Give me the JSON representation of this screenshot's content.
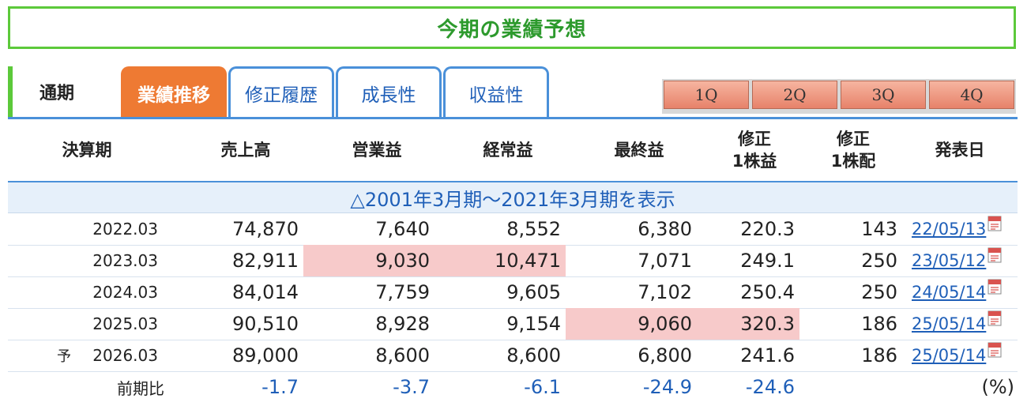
{
  "title": "今期の業績予想",
  "tabs": {
    "first": "通期",
    "items": [
      "業績推移",
      "修正履歴",
      "成長性",
      "収益性"
    ]
  },
  "quarters": [
    "1Q",
    "2Q",
    "3Q",
    "4Q"
  ],
  "header": {
    "period": "決算期",
    "sales": "売上高",
    "operating": "営業益",
    "ordinary": "経常益",
    "net": "最終益",
    "eps_l1": "修正",
    "eps_l2": "1株益",
    "div_l1": "修正",
    "div_l2": "1株配",
    "date": "発表日"
  },
  "expand_link": "△2001年3月期～2021年3月期を表示",
  "rows": [
    {
      "prefix": "",
      "period": "2022.03",
      "sales": "74,870",
      "operating": "7,640",
      "ordinary": "8,552",
      "net": "6,380",
      "eps": "220.3",
      "div": "143",
      "date": "22/05/13"
    },
    {
      "prefix": "",
      "period": "2023.03",
      "sales": "82,911",
      "operating": "9,030",
      "ordinary": "10,471",
      "net": "7,071",
      "eps": "249.1",
      "div": "250",
      "date": "23/05/12"
    },
    {
      "prefix": "",
      "period": "2024.03",
      "sales": "84,014",
      "operating": "7,759",
      "ordinary": "9,605",
      "net": "7,102",
      "eps": "250.4",
      "div": "250",
      "date": "24/05/14"
    },
    {
      "prefix": "",
      "period": "2025.03",
      "sales": "90,510",
      "operating": "8,928",
      "ordinary": "9,154",
      "net": "9,060",
      "eps": "320.3",
      "div": "186",
      "date": "25/05/14"
    },
    {
      "prefix": "予",
      "period": "2026.03",
      "sales": "89,000",
      "operating": "8,600",
      "ordinary": "8,600",
      "net": "6,800",
      "eps": "241.6",
      "div": "186",
      "date": "25/05/14"
    }
  ],
  "ratio_row": {
    "label": "前期比",
    "sales": "-1.7",
    "operating": "-3.7",
    "ordinary": "-6.1",
    "net": "-24.9",
    "eps": "-24.6",
    "unit": "(%)"
  },
  "colors": {
    "accent_green": "#5cc93a",
    "tab_active": "#ee7a33",
    "link_blue": "#1f5fb8",
    "highlight": "#f7caca"
  },
  "icons": {
    "date_attachment": "pdf-icon"
  }
}
